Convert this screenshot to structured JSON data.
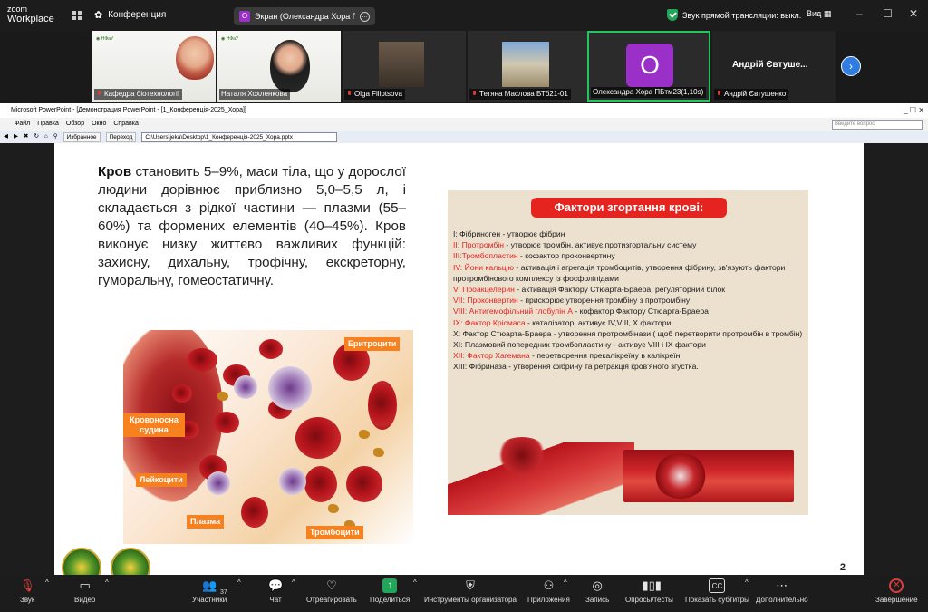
{
  "app": {
    "logo_line1": "zoom",
    "logo_line2": "Workplace",
    "meeting_tab": "Конференция",
    "share_tab": "Экран (Олександра Хора ПБтм2",
    "share_avatar": "О",
    "live_status": "Звук прямой трансляции: выкл.",
    "view": "Вид",
    "minimize": "–",
    "maximize": "☐",
    "close": "✕"
  },
  "participants": [
    {
      "name": "Кафедра біотехнології"
    },
    {
      "name": "Наталя Хохленкова"
    },
    {
      "name": "Olga Filiptsova"
    },
    {
      "name": "Тетяна Маслова БТб21-01"
    },
    {
      "name": "Олександра Хора ПБтм23(1,10s)",
      "avatar": "О"
    },
    {
      "name": "Андрій Євтушенко",
      "display": "Андрій Євтуше..."
    }
  ],
  "ppt": {
    "title": "Microsoft PowerPoint - [Демонстрация PowerPoint - [1_Конференція-2025_Хора]]",
    "menu": [
      "Файл",
      "Правка",
      "Обзор",
      "Окно",
      "Справка"
    ],
    "ask_placeholder": "Введите вопрос",
    "favorites": "Избранное",
    "goto": "Переход",
    "path": "C:\\Users\\jeka\\Desktop\\1_Конференція-2025_Хора.pptx"
  },
  "slide": {
    "lead_bold": "Кров",
    "text": " становить 5–9%, маси тіла, що у дорослої людини дорівнює приблизно 5,0–5,5 л, і складається з рідкої частини — плазми (55–60%) та формених елементів (40–45%). Кров виконує низку життєво важливих функцій: захисну, дихальну, трофічну, екскреторну, гуморальну, гомеостатичну.",
    "labels": {
      "erythrocytes": "Еритроцити",
      "vessel": "Кровоносна судина",
      "leukocytes": "Лейкоцити",
      "plasma": "Плазма",
      "platelets": "Тромбоцити"
    },
    "card_title": "Фактори згортання крові:",
    "factors": [
      {
        "num": "І: ",
        "name": "Фібриноген",
        "desc": " - утворює фібрин",
        "red": false
      },
      {
        "num": "ІІ: ",
        "name": "Протромбін",
        "desc": " - утворює тромбін, активує протизгортальну систему",
        "red": true
      },
      {
        "num": "ІІІ:",
        "name": "Тромбопластин",
        "desc": " - кофактор проконвертину",
        "red": true
      },
      {
        "num": "IV: ",
        "name": "Йони кальцію",
        "desc": " - активація і агрегація тромбоцитів, утворення фібрину, зв'язують фактори протромбінового комплексу із фосфоліпідами",
        "red": true
      },
      {
        "num": "V: ",
        "name": "Проакцелерин",
        "desc": " - активація Фактору Стюарта-Браера, регуляторний білок",
        "red": true
      },
      {
        "num": "VII: ",
        "name": "Проконвертин",
        "desc": " - прискорює утворення тромбіну з протромбіну",
        "red": true
      },
      {
        "num": "VIII: ",
        "name": "Антигемофільний глобулін А",
        "desc": " - кофактор Фактору Стюарта-Браера",
        "red": true
      },
      {
        "num": "IX: ",
        "name": "Фактор Крісмаса",
        "desc": " - каталізатор, активує IV,VIII, X фактори",
        "red": true
      },
      {
        "num": "X: ",
        "name": "Фактор Стюарта-Браера",
        "desc": " - утворення протромбінази ( щоб перетворити протромбін в тромбін)",
        "red": false
      },
      {
        "num": "XI: ",
        "name": "Плазмовий попередник тромбопластину",
        "desc": " - активує VIII і IX фактори",
        "red": false
      },
      {
        "num": "XII: ",
        "name": "Фактор Хагемана",
        "desc": " - перетворення прекалікреїну в калікреїн",
        "red": true
      },
      {
        "num": "XIII: ",
        "name": "Фібриназа",
        "desc": " - утворення фібрину та ретракція кров'яного згустка.",
        "red": false
      }
    ],
    "page_number": "2"
  },
  "toolbar": {
    "audio": "Звук",
    "video": "Видео",
    "participants": "Участники",
    "participants_count": "37",
    "chat": "Чат",
    "react": "Отреагировать",
    "share": "Поделиться",
    "host_tools": "Инструменты организатора",
    "apps": "Приложения",
    "record": "Запись",
    "polls": "Опросы/тесты",
    "captions": "Показать субтитры",
    "more": "Дополнительно",
    "end": "Завершение"
  }
}
